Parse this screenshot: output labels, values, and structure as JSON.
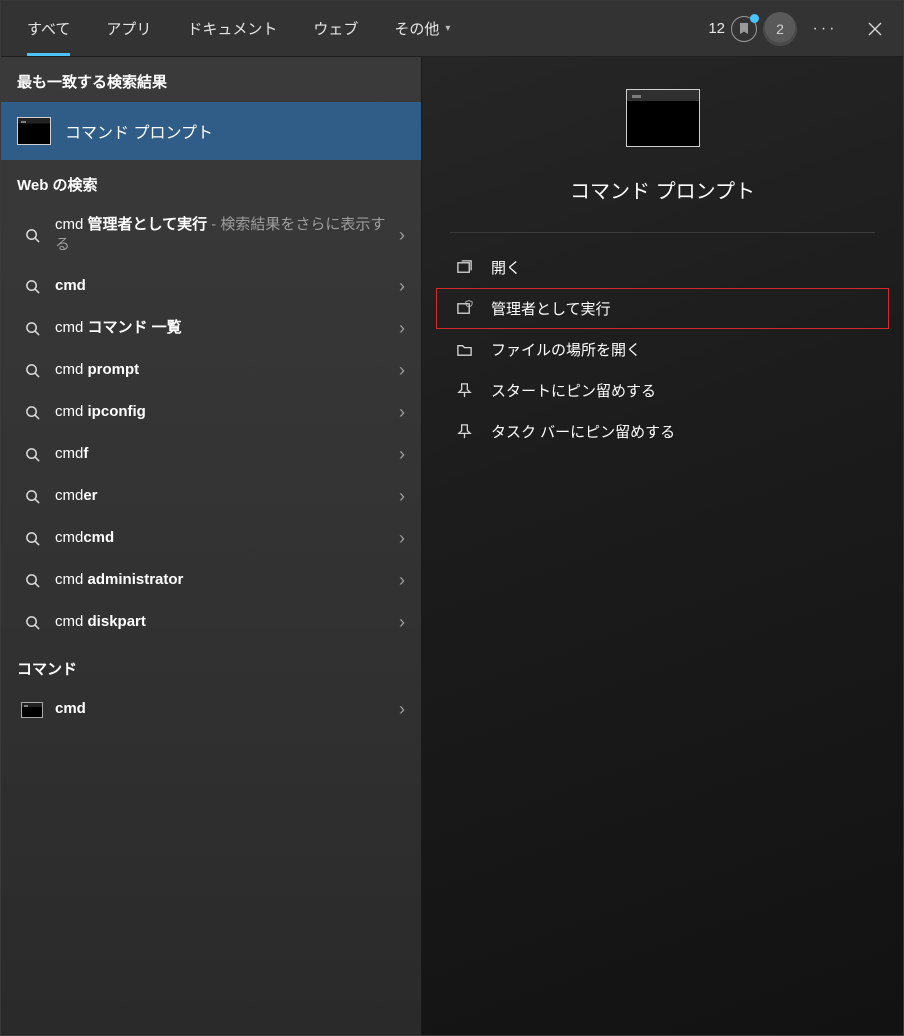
{
  "header": {
    "tabs": [
      {
        "label": "すべて",
        "active": true
      },
      {
        "label": "アプリ"
      },
      {
        "label": "ドキュメント"
      },
      {
        "label": "ウェブ"
      },
      {
        "label": "その他",
        "dropdown": true
      }
    ],
    "rewards_count": "12",
    "avatar_initial": "2"
  },
  "left": {
    "best_title": "最も一致する検索結果",
    "best_item": "コマンド プロンプト",
    "web_title": "Web の検索",
    "web_items": [
      {
        "pre": "cmd ",
        "bold": "管理者として実行",
        "suffix": " - 検索結果をさらに表示する"
      },
      {
        "pre": "",
        "bold": "cmd",
        "suffix": ""
      },
      {
        "pre": "cmd ",
        "bold": "コマンド 一覧",
        "suffix": ""
      },
      {
        "pre": "cmd ",
        "bold": "prompt",
        "suffix": ""
      },
      {
        "pre": "cmd ",
        "bold": "ipconfig",
        "suffix": ""
      },
      {
        "pre": "cmd",
        "bold": "f",
        "suffix": ""
      },
      {
        "pre": "cmd",
        "bold": "er",
        "suffix": ""
      },
      {
        "pre": "cmd",
        "bold": "cmd",
        "suffix": ""
      },
      {
        "pre": "cmd ",
        "bold": "administrator",
        "suffix": ""
      },
      {
        "pre": "cmd ",
        "bold": "diskpart",
        "suffix": ""
      }
    ],
    "command_title": "コマンド",
    "command_item": "cmd"
  },
  "right": {
    "title": "コマンド プロンプト",
    "actions": [
      {
        "label": "開く",
        "icon": "open"
      },
      {
        "label": "管理者として実行",
        "icon": "shield",
        "highlight": true
      },
      {
        "label": "ファイルの場所を開く",
        "icon": "folder"
      },
      {
        "label": "スタートにピン留めする",
        "icon": "pin"
      },
      {
        "label": "タスク バーにピン留めする",
        "icon": "pin"
      }
    ]
  }
}
